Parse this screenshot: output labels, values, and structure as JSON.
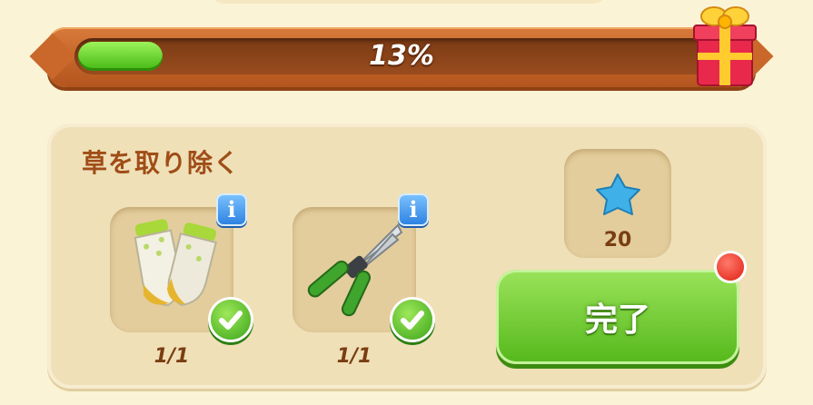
{
  "progress": {
    "percent_text": "13%",
    "value": 0.13
  },
  "task": {
    "title": "草を取り除く",
    "items": [
      {
        "icon": "gloves-icon",
        "count": "1/1",
        "done": true
      },
      {
        "icon": "pruning-shears-icon",
        "count": "1/1",
        "done": true
      }
    ]
  },
  "reward": {
    "icon": "blue-star-icon",
    "amount": "20"
  },
  "actions": {
    "complete_label": "完了"
  },
  "colors": {
    "accent_green": "#55b81b",
    "bar_brown": "#b3551d",
    "title_brown": "#a04d17",
    "info_blue": "#2a7fe0"
  }
}
